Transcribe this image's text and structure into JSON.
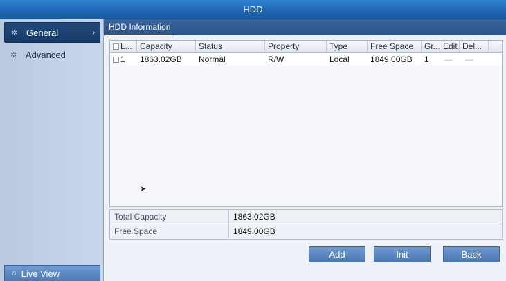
{
  "window": {
    "title": "HDD"
  },
  "sidebar": {
    "items": [
      {
        "label": "General",
        "icon": "gear-icon",
        "selected": true
      },
      {
        "label": "Advanced",
        "icon": "gear-icon",
        "selected": false
      }
    ],
    "live_view": {
      "label": "Live View",
      "icon": "home-icon"
    }
  },
  "tabs": [
    {
      "label": "HDD Information"
    }
  ],
  "hdd_table": {
    "columns": [
      "L...",
      "Capacity",
      "Status",
      "Property",
      "Type",
      "Free Space",
      "Gr...",
      "Edit",
      "Del..."
    ],
    "rows": [
      {
        "label": "1",
        "capacity": "1863.02GB",
        "status": "Normal",
        "property": "R/W",
        "type": "Local",
        "free_space": "1849.00GB",
        "group": "1",
        "edit": "—",
        "delete": "—"
      }
    ]
  },
  "summary": {
    "total_capacity_label": "Total Capacity",
    "total_capacity_value": "1863.02GB",
    "free_space_label": "Free Space",
    "free_space_value": "1849.00GB"
  },
  "buttons": {
    "add": "Add",
    "init": "Init",
    "back": "Back"
  },
  "colors": {
    "accent": "#1f68b4",
    "sidebar_selected": "#1d4373",
    "button": "#5a87c2"
  }
}
